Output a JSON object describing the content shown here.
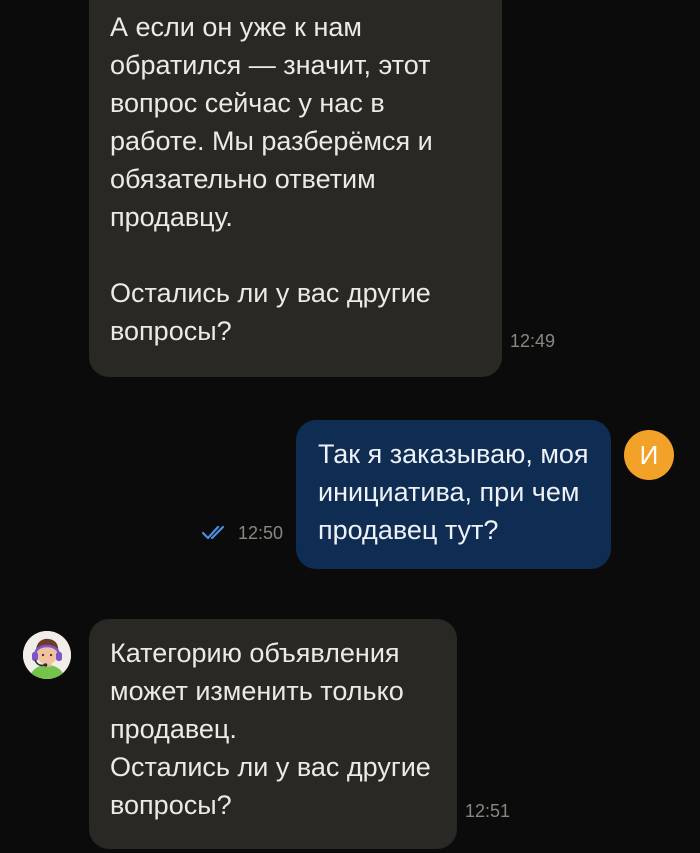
{
  "conversation": {
    "messages": [
      {
        "sender": "support",
        "text": "А если он уже к нам\nобратился — значит, этот\nвопрос сейчас у нас в\nработе. Мы разберёмся и\nобязательно ответим\nпродавцу.\n\nОстались ли у вас другие\nвопросы?",
        "time": "12:49"
      },
      {
        "sender": "user",
        "text": "Так я заказываю, моя\nинициатива, при чем\nпродавец тут?",
        "time": "12:50",
        "status_icon": "double-check-icon",
        "avatar_letter": "И",
        "avatar_color": "#f2a229"
      },
      {
        "sender": "support",
        "text": "Категорию объявления\nможет изменить только\nпродавец.\nОстались ли у вас другие\nвопросы?",
        "time": "12:51",
        "avatar_icon": "support-agent-avatar-icon"
      }
    ]
  },
  "colors": {
    "background": "#0b0b0b",
    "incoming_bubble": "#2a2824",
    "outgoing_bubble": "#0f2d52",
    "timestamp": "#8a8781",
    "read_check": "#4a8fe0"
  }
}
